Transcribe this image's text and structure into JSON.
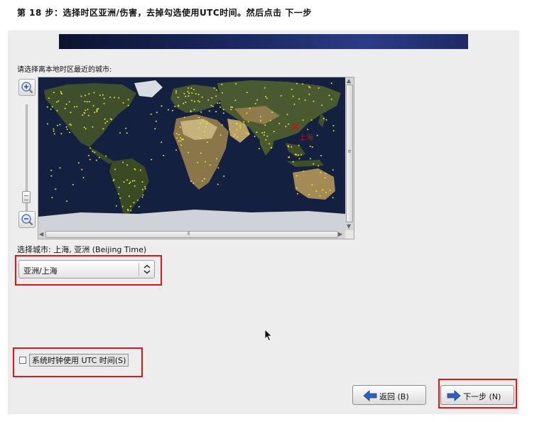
{
  "step_heading": "第 18 步：选择时区亚洲/伤害，去掉勾选使用UTC时间。然后点击 下一步",
  "map": {
    "prompt": "请选择离本地时区最近的城市:",
    "marker_label": "上海",
    "zoom_in_icon": "zoom-in-icon",
    "zoom_out_icon": "zoom-out-icon"
  },
  "timezone": {
    "selected_city_label": "选择城市: 上海, 亚洲 (Beijing Time)",
    "select_value": "亚洲/上海"
  },
  "utc": {
    "label": "系统时钟使用 UTC 时间(S)",
    "checked": false
  },
  "buttons": {
    "back_label": "返回 (B)",
    "next_label": "下一步 (N)"
  },
  "colors": {
    "highlight": "#e01818",
    "ocean": "#142040",
    "city_dot": "#e6e62a",
    "marker": "#cc1111",
    "arrow": "#2a62c8"
  }
}
